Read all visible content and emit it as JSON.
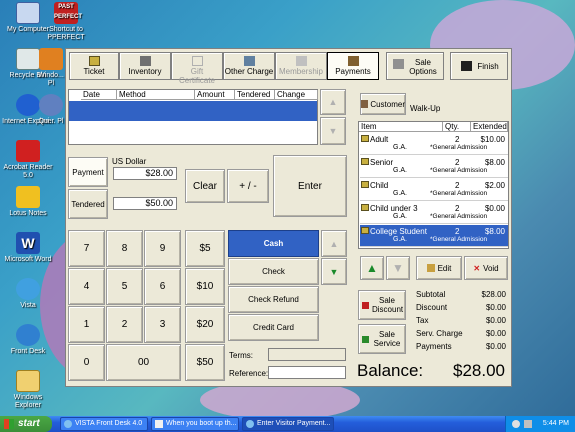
{
  "desktop": {
    "icons": [
      {
        "label": "My Computer",
        "icon": "computer-icon"
      },
      {
        "label": "Shortcut to PPERFECT",
        "icon": "shortcut-icon"
      },
      {
        "label": "Recycle Bin",
        "icon": "recycle-bin-icon"
      },
      {
        "label": "Windo... Pl",
        "icon": "media-player-icon"
      },
      {
        "label": "Internet Explorer",
        "icon": "internet-explorer-icon"
      },
      {
        "label": "Qui... Pl",
        "icon": "quicktime-icon"
      },
      {
        "label": "Acrobat Reader 5.0",
        "icon": "acrobat-icon"
      },
      {
        "label": "Lotus Notes",
        "icon": "lotus-notes-icon"
      },
      {
        "label": "Microsoft Word",
        "icon": "word-icon"
      },
      {
        "label": "Vista",
        "icon": "vista-icon"
      },
      {
        "label": "Front Desk",
        "icon": "front-desk-icon"
      },
      {
        "label": "Windows Explorer",
        "icon": "windows-explorer-icon"
      }
    ],
    "shortcut_badge": "PAST PERFECT"
  },
  "toolbar": {
    "ticket": "Ticket",
    "inventory": "Inventory",
    "gift_certificate": "Gift Certificate",
    "other_charge": "Other Charge",
    "membership": "Membership",
    "payments": "Payments",
    "sale_options": "Sale Options",
    "finish": "Finish"
  },
  "payments_grid": {
    "columns": [
      "Date",
      "Method",
      "Amount",
      "Tendered",
      "Change"
    ]
  },
  "payment_entry": {
    "currency_label": "US Dollar",
    "payment_label": "Payment",
    "payment_value": "$28.00",
    "tendered_label": "Tendered",
    "tendered_value": "$50.00",
    "clear": "Clear",
    "plus_minus": "+ / -",
    "enter": "Enter"
  },
  "keypad": {
    "keys": [
      "7",
      "8",
      "9",
      "4",
      "5",
      "6",
      "1",
      "2",
      "3",
      "0",
      "00"
    ],
    "cash_amounts": [
      "$5",
      "$10",
      "$20",
      "$50"
    ]
  },
  "methods": {
    "items": [
      "Cash",
      "Check",
      "Check Refund",
      "Credit Card"
    ],
    "selected": "Cash"
  },
  "terms_label": "Terms:",
  "reference_label": "Reference:",
  "customer": {
    "button": "Customer",
    "value": "Walk-Up"
  },
  "cart": {
    "columns": [
      "Item",
      "Qty.",
      "Extended"
    ],
    "items": [
      {
        "name": "Adult",
        "sub": "G.A.",
        "qty": "2",
        "addl": "*General Admission",
        "extended": "$10.00"
      },
      {
        "name": "Senior",
        "sub": "G.A.",
        "qty": "2",
        "addl": "*General Admission",
        "extended": "$8.00"
      },
      {
        "name": "Child",
        "sub": "G.A.",
        "qty": "2",
        "addl": "*General Admission",
        "extended": "$2.00"
      },
      {
        "name": "Child under 3",
        "sub": "G.A.",
        "qty": "2",
        "addl": "*General Admission",
        "extended": "$0.00"
      },
      {
        "name": "College Student",
        "sub": "G.A.",
        "qty": "2",
        "addl": "*General Admission",
        "extended": "$8.00"
      }
    ]
  },
  "cart_actions": {
    "edit": "Edit",
    "void": "Void"
  },
  "sale_discount": "Sale Discount",
  "sale_service": "Sale Service",
  "summary": {
    "rows": [
      {
        "label": "Subtotal",
        "value": "$28.00"
      },
      {
        "label": "Discount",
        "value": "$0.00"
      },
      {
        "label": "Tax",
        "value": "$0.00"
      },
      {
        "label": "Serv. Charge",
        "value": "$0.00"
      },
      {
        "label": "Payments",
        "value": "$0.00"
      }
    ],
    "balance_label": "Balance:",
    "balance_value": "$28.00"
  },
  "taskbar": {
    "start": "start",
    "tasks": [
      "VISTA Front Desk 4.0",
      "When you boot up th...",
      "Enter Visitor Payment..."
    ],
    "clock": "5:44 PM"
  },
  "colors": {
    "selection_blue": "#3162c4",
    "window_bg": "#ece9d8",
    "taskbar_blue": "#245edb",
    "start_green": "#3b8e38"
  }
}
